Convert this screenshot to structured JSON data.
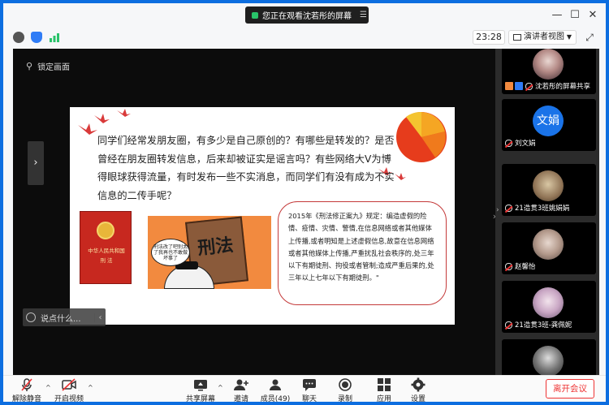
{
  "titlebar": {
    "sharing_status": "您正在观看沈若彤的屏幕",
    "menu_glyph": "☰",
    "controls": [
      "—",
      "☐",
      "✕"
    ]
  },
  "toolbar": {
    "timer": "23:28",
    "view_mode": "演讲者视图",
    "view_dropdown_glyph": "▼",
    "fullscreen_glyph": "⤢",
    "info_icon": "info-icon",
    "shield_icon": "shield-icon",
    "signal_icon": "signal-icon"
  },
  "stage": {
    "lock_label": "锁定画面",
    "lock_icon": "pin-icon",
    "left_arrow": "›",
    "right_arrow": "›",
    "chat_placeholder": "说点什么...",
    "chat_arrow": "‹",
    "slide": {
      "question": "同学们经常发朋友圈，有多少是自己原创的？有哪些是转发的？是否曾经在朋友圈转发信息，后来却被证实是谣言吗？有些网络大V为博得眼球获得流量，有时发布一些不实消息，而同学们有没有成为不实信息的二传手呢？",
      "book_line1": "中华人民共和国",
      "book_line2": "刑 法",
      "cartoon_title": "刑法",
      "cartoon_bubble": "刑法改了吧别太了我再也不敢做坏事了",
      "law_text": "2015年《刑法修正案九》规定：编造虚假的险情、疫情、灾情、警情,在信息网络或者其他媒体上传播,或者明知是上述虚假信息,故意在信息网络或者其他媒体上传播,严重扰乱社会秩序的,处三年以下有期徒刑、拘役或者管制;造成严重后果的,处三年以上七年以下有期徒刑。\""
    }
  },
  "participants": [
    {
      "name": "沈若彤的屏幕共享",
      "avatar": "photo",
      "sharing": true
    },
    {
      "name": "刘文娟",
      "avatar_text": "文娟"
    },
    {
      "name": "21造贯3班姚娟娟",
      "avatar": "photo"
    },
    {
      "name": "赵馨怡",
      "avatar": "photo"
    },
    {
      "name": "21造贯3班-龚佩妮",
      "avatar": "photo"
    }
  ],
  "participants_collapse": "›",
  "bottombar": {
    "unmute": "解除静音",
    "start_video": "开启视频",
    "share_screen": "共享屏幕",
    "invite": "邀请",
    "members": "成员(49)",
    "chat": "聊天",
    "record": "录制",
    "apps": "应用",
    "settings": "设置",
    "leave": "离开会议",
    "caret": "^"
  },
  "colors": {
    "accent_blue": "#1a73e8",
    "share_green": "#29c36a",
    "leave_red": "#e33333",
    "slide_red": "#c43a3a"
  }
}
